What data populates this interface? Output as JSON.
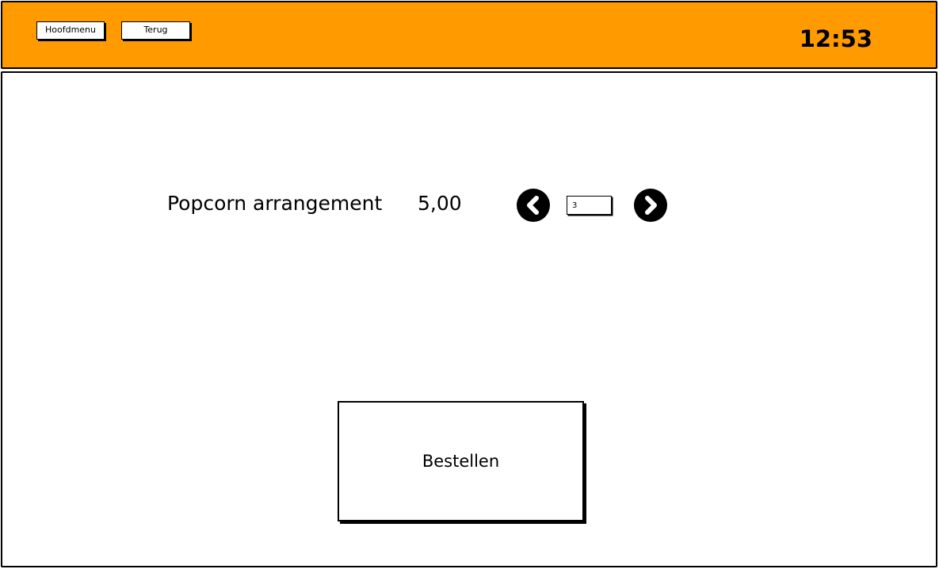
{
  "header": {
    "background_color": "#ff9a00",
    "menu_button_label": "Hoofdmenu",
    "back_button_label": "Terug",
    "clock": "12:53"
  },
  "product": {
    "name": "Popcorn arrangement",
    "price": "5,00",
    "quantity": "3",
    "decrease_icon": "chevron-left-icon",
    "increase_icon": "chevron-right-icon"
  },
  "order": {
    "button_label": "Bestellen"
  }
}
